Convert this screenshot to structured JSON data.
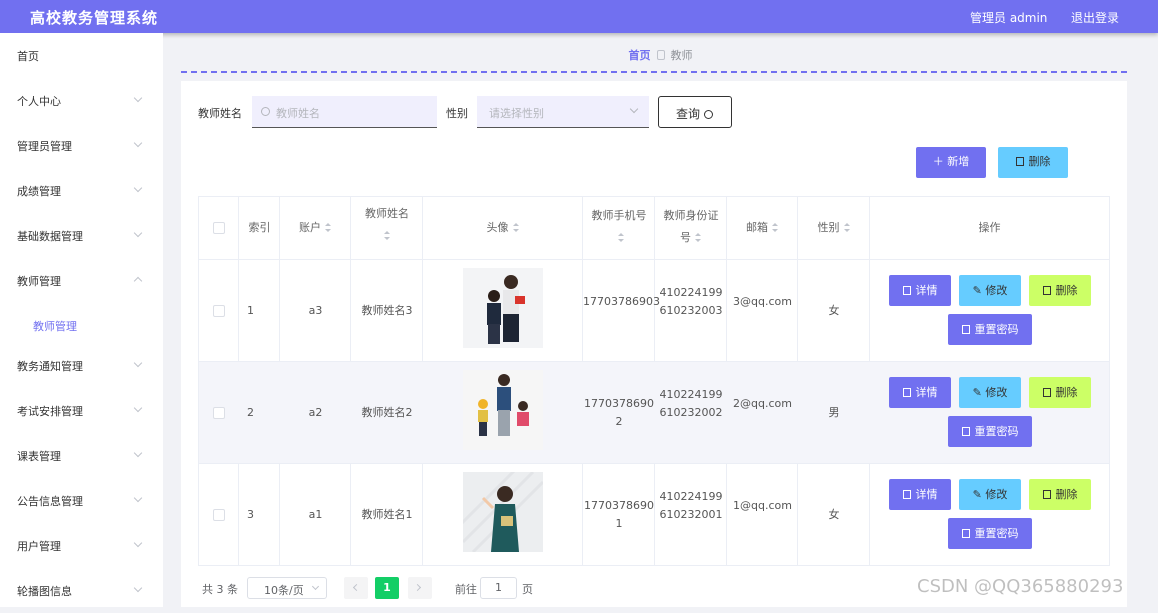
{
  "app_title": "高校教务管理系统",
  "header": {
    "user": "管理员 admin",
    "logout": "退出登录"
  },
  "sidebar": {
    "items": [
      {
        "label": "首页",
        "chevron": "none"
      },
      {
        "label": "个人中心",
        "chevron": "down"
      },
      {
        "label": "管理员管理",
        "chevron": "down"
      },
      {
        "label": "成绩管理",
        "chevron": "down"
      },
      {
        "label": "基础数据管理",
        "chevron": "down"
      },
      {
        "label": "教师管理",
        "chevron": "up"
      },
      {
        "label": "教师管理",
        "sub": true,
        "active": true
      },
      {
        "label": "教务通知管理",
        "chevron": "down"
      },
      {
        "label": "考试安排管理",
        "chevron": "down"
      },
      {
        "label": "课表管理",
        "chevron": "down"
      },
      {
        "label": "公告信息管理",
        "chevron": "down"
      },
      {
        "label": "用户管理",
        "chevron": "down"
      },
      {
        "label": "轮播图信息",
        "chevron": "down"
      }
    ]
  },
  "breadcrumb": {
    "home": "首页",
    "current": "教师"
  },
  "search": {
    "name_label": "教师姓名",
    "name_placeholder": "教师姓名",
    "gender_label": "性别",
    "gender_placeholder": "请选择性别",
    "query_button": "查询"
  },
  "actions": {
    "add": "新增",
    "delete": "删除"
  },
  "table": {
    "headers": {
      "index": "索引",
      "account": "账户",
      "name": "教师姓名",
      "avatar": "头像",
      "phone": "教师手机号",
      "idcard": "教师身份证号",
      "email": "邮箱",
      "gender": "性别",
      "ops": "操作"
    },
    "rows": [
      {
        "index": "1",
        "account": "a3",
        "name": "教师姓名3",
        "phone": "17703786903",
        "idcard": "410224199610232003",
        "email": "3@qq.com",
        "gender": "女"
      },
      {
        "index": "2",
        "account": "a2",
        "name": "教师姓名2",
        "phone": "17703786902",
        "idcard": "410224199610232002",
        "email": "2@qq.com",
        "gender": "男"
      },
      {
        "index": "3",
        "account": "a1",
        "name": "教师姓名1",
        "phone": "17703786901",
        "idcard": "410224199610232001",
        "email": "1@qq.com",
        "gender": "女"
      }
    ],
    "row_buttons": {
      "detail": "详情",
      "edit": "修改",
      "delete": "删除",
      "reset": "重置密码"
    }
  },
  "pagination": {
    "total": "共 3 条",
    "page_size": "10条/页",
    "current_page": "1",
    "goto": "前往",
    "goto_value": "1",
    "page_unit": "页"
  },
  "watermark": "CSDN @QQ365880293",
  "colors": {
    "primary": "#7170f0",
    "info": "#66ccff",
    "warning": "#ccff66",
    "active_page": "#13ce66"
  }
}
